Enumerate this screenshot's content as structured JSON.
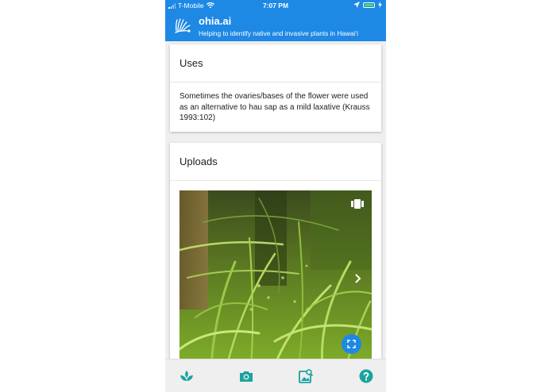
{
  "status_bar": {
    "carrier": "T-Mobile",
    "time": "7:07 PM"
  },
  "app_bar": {
    "title": "ohia.ai",
    "subtitle": "Helping to identify native and invasive plants in Hawaiʻi"
  },
  "uses_card": {
    "heading": "Uses",
    "body": "Sometimes the ovaries/bases of the flower were used as an alternative to hau sap as a mild laxative (Krauss 1993:102)"
  },
  "uploads_card": {
    "heading": "Uploads"
  },
  "colors": {
    "primary": "#1e88e5",
    "accent_teal": "#1aa3a0",
    "battery_green": "#4cd964"
  },
  "icons": {
    "bottom_nav": [
      "plant-icon",
      "camera-icon",
      "image-search-icon",
      "help-icon"
    ]
  }
}
